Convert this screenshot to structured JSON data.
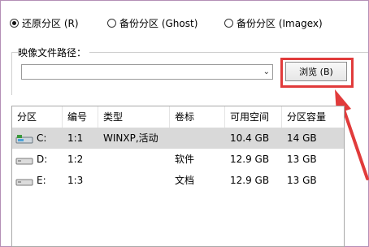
{
  "restore_options": [
    {
      "label": "还原分区 (R)",
      "checked": true
    },
    {
      "label": "备份分区 (Ghost)",
      "checked": false
    },
    {
      "label": "备份分区 (Imagex)",
      "checked": false
    }
  ],
  "image_path": {
    "label": "映像文件路径：",
    "value": ""
  },
  "browse_button": {
    "label": "浏览 (B)"
  },
  "highlight_color": "#e13b3b",
  "table": {
    "columns": [
      "分区",
      "编号",
      "类型",
      "卷标",
      "可用空间",
      "分区容量"
    ],
    "rows": [
      {
        "partition": "C:",
        "number": "1:1",
        "type": "WINXP,活动",
        "label": "",
        "free": "10.4 GB",
        "capacity": "14 GB",
        "icon": "system-drive-icon"
      },
      {
        "partition": "D:",
        "number": "1:2",
        "type": "",
        "label": "软件",
        "free": "12.9 GB",
        "capacity": "13 GB",
        "icon": "drive-icon"
      },
      {
        "partition": "E:",
        "number": "1:3",
        "type": "",
        "label": "文档",
        "free": "12.9 GB",
        "capacity": "13 GB",
        "icon": "drive-icon"
      }
    ]
  }
}
